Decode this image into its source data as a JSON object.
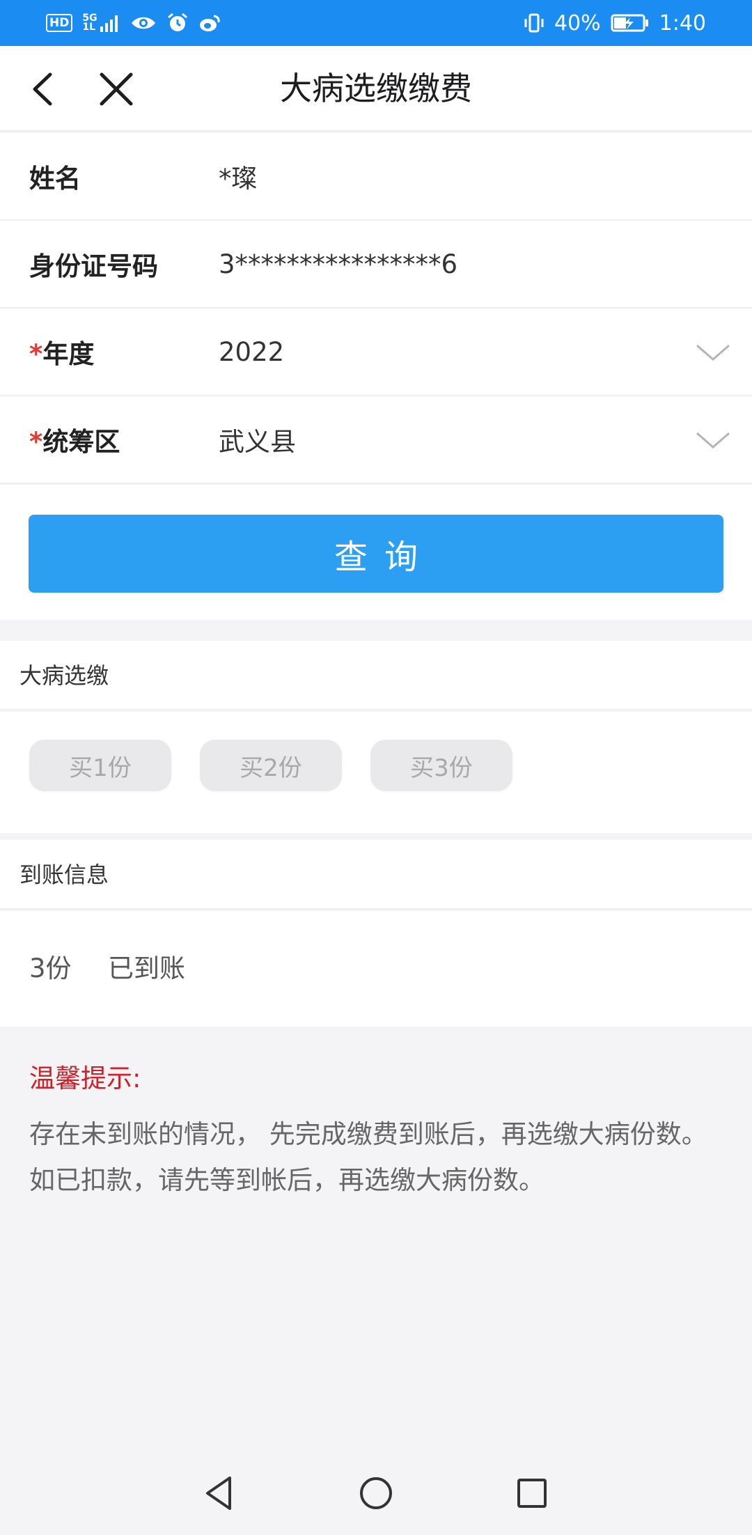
{
  "status_bar": {
    "left_badge": "HD",
    "network": "5G",
    "network_sub": "1L",
    "battery_percent": "40%",
    "time": "1:40"
  },
  "header": {
    "title": "大病选缴缴费"
  },
  "form": {
    "name_label": "姓名",
    "name_value": "*璨",
    "id_label": "身份证号码",
    "id_value": "3****************6",
    "year_required": "*",
    "year_label": "年度",
    "year_value": "2022",
    "region_required": "*",
    "region_label": "统筹区",
    "region_value": "武义县"
  },
  "query_button": "查询",
  "select_section": {
    "title": "大病选缴",
    "options": [
      "买1份",
      "买2份",
      "买3份"
    ]
  },
  "arrival_section": {
    "title": "到账信息",
    "count": "3份",
    "status": "已到账"
  },
  "tips": {
    "title": "温馨提示:",
    "body": "存在未到账的情况， 先完成缴费到账后，再选缴大病份数。如已扣款，请先等到帐后，再选缴大病份数。"
  },
  "colors": {
    "status_bar": "#1a8cf2",
    "primary_button": "#2d9ff2",
    "required_mark": "#e53935",
    "tips_title": "#d0202a"
  },
  "icons": {
    "back": "chevron-left-icon",
    "close": "close-icon",
    "dropdown": "chevron-down-icon",
    "nav_back": "triangle-back-icon",
    "nav_home": "circle-home-icon",
    "nav_recent": "square-recent-icon"
  }
}
